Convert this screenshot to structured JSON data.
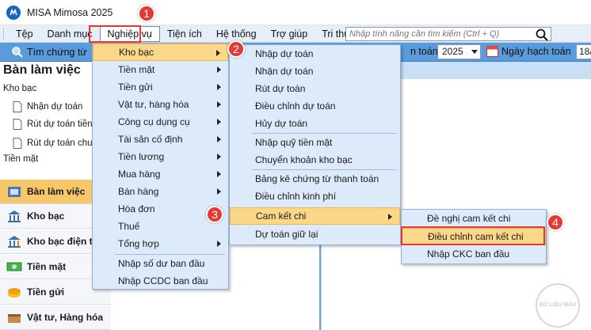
{
  "app": {
    "title": "MISA Mimosa 2025"
  },
  "menubar": {
    "items": [
      {
        "label": "Tệp"
      },
      {
        "label": "Danh mục"
      },
      {
        "label": "Nghiệp vụ"
      },
      {
        "label": "Tiện ích"
      },
      {
        "label": "Hệ thống"
      },
      {
        "label": "Trợ giúp"
      },
      {
        "label": "Tri thức"
      }
    ],
    "search_placeholder": "Nhập tính năng cần tìm kiếm (Ctrl + Q)"
  },
  "toolbar": {
    "find_label": "Tìm chứng từ",
    "year_label": "n toán",
    "year_value": "2025",
    "date_label": "Ngày hạch toán",
    "date_value": "18/"
  },
  "left_panel": {
    "title": "Bàn làm việc",
    "section_kho_bac": "Kho bạc",
    "kho_bac_items": [
      "Nhận dự toán",
      "Rút dự toán tiền",
      "Rút dự toán chuy"
    ],
    "section_tien_mat": "Tiền mặt",
    "nav": [
      {
        "label": "Bàn làm việc",
        "icon": "home-icon"
      },
      {
        "label": "Kho bạc",
        "icon": "bank-icon"
      },
      {
        "label": "Kho bạc điện tử",
        "icon": "e-bank-icon"
      },
      {
        "label": "Tiền mặt",
        "icon": "cash-icon"
      },
      {
        "label": "Tiền gửi",
        "icon": "deposit-icon"
      },
      {
        "label": "Vật tư, Hàng hóa",
        "icon": "goods-icon"
      }
    ]
  },
  "menu_nghiep_vu": {
    "items": [
      "Kho bạc",
      "Tiền mặt",
      "Tiền gửi",
      "Vật tư, hàng hóa",
      "Công cụ dụng cụ",
      "Tài sản cố định",
      "Tiền lương",
      "Mua hàng",
      "Bán hàng",
      "Hóa đơn",
      "Thuế",
      "Tổng hợp",
      "Nhập số dư ban đầu",
      "Nhập CCDC ban đầu"
    ]
  },
  "menu_kho_bac": {
    "items": [
      "Nhập dự toán",
      "Nhận dự toán",
      "Rút dự toán",
      "Điều chỉnh dự toán",
      "Hủy dự toán",
      "Nhập quỹ tiền mặt",
      "Chuyển khoản kho bạc",
      "Bảng kê chứng từ thanh toán",
      "Điều chỉnh kinh phí",
      "Cam kết chi",
      "Dự toán giữ lại"
    ]
  },
  "menu_cam_ket_chi": {
    "items": [
      "Đề nghị cam kết chi",
      "Điều chỉnh cam kết chi",
      "Nhập CKC ban đầu"
    ]
  },
  "steps": [
    "1",
    "2",
    "3",
    "4"
  ],
  "watermark": "DỮ LIỆU MẪU",
  "colors": {
    "toolbar": "#5a9bdc",
    "menu_bg": "#dceafa",
    "highlight": "#fbd78a",
    "annotation": "#e53935",
    "active_nav": "#f8c76a"
  }
}
